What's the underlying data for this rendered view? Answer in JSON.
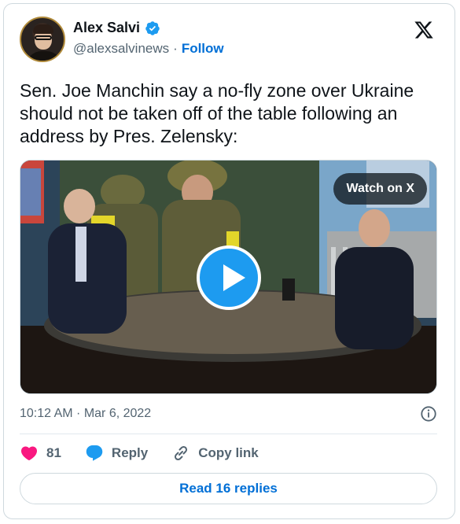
{
  "author": {
    "name": "Alex Salvi",
    "handle": "@alexsalvinews",
    "separator": "·",
    "follow_label": "Follow"
  },
  "tweet": {
    "text": "Sen. Joe Manchin say a no-fly zone over Ukraine should not be taken off of the table following an address by Pres. Zelensky:"
  },
  "media": {
    "watch_label": "Watch on X"
  },
  "meta": {
    "timestamp": "10:12 AM · Mar 6, 2022"
  },
  "actions": {
    "like_count": "81",
    "reply_label": "Reply",
    "copy_label": "Copy link"
  },
  "footer": {
    "read_replies_label": "Read 16 replies"
  },
  "colors": {
    "accent": "#1d9bf0",
    "link": "#006fd6",
    "like": "#f91880"
  },
  "icons": [
    "verified-badge-icon",
    "x-logo-icon",
    "play-icon",
    "info-icon",
    "heart-icon",
    "reply-bubble-icon",
    "link-icon"
  ]
}
